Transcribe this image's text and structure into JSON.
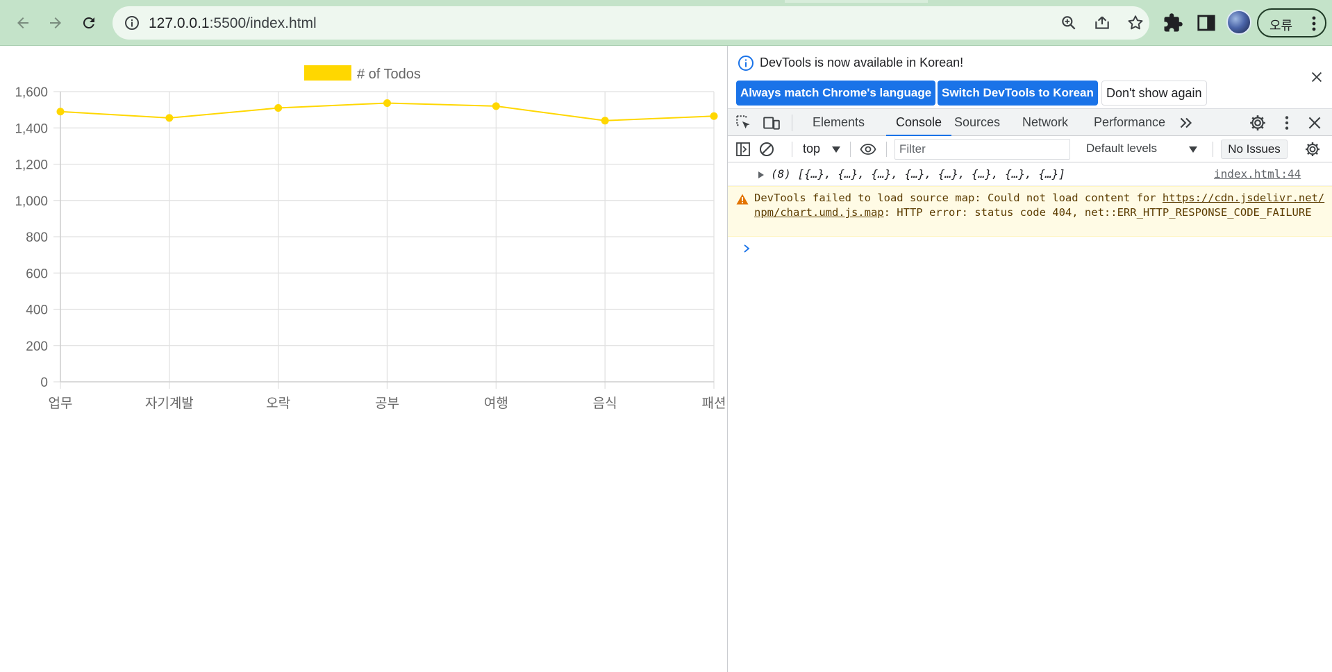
{
  "browser": {
    "url_host": "127.0.0.1",
    "url_path": ":5500/index.html",
    "profile_chip_label": "오류"
  },
  "chart_data": {
    "type": "line",
    "categories": [
      "업무",
      "자기계발",
      "오락",
      "공부",
      "여행",
      "음식",
      "패션"
    ],
    "series": [
      {
        "name": "# of Todos",
        "values": [
          1490,
          1455,
          1510,
          1537,
          1520,
          1440,
          1465
        ],
        "color": "#ffd700"
      }
    ],
    "y_ticks": [
      "0",
      "200",
      "400",
      "600",
      "800",
      "1,000",
      "1,200",
      "1,400",
      "1,600"
    ],
    "ylim": [
      0,
      1600
    ],
    "grid": true,
    "legend_position": "top"
  },
  "devtools": {
    "banner": {
      "message": "DevTools is now available in Korean!",
      "btn_match": "Always match Chrome's language",
      "btn_switch": "Switch DevTools to Korean",
      "btn_dismiss": "Don't show again"
    },
    "tabs": [
      "Elements",
      "Console",
      "Sources",
      "Network",
      "Performance"
    ],
    "active_tab": "Console",
    "console_bar": {
      "context": "top",
      "filter_placeholder": "Filter",
      "levels": "Default levels",
      "issues": "No Issues"
    },
    "log": {
      "object_line": "(8) [{…}, {…}, {…}, {…}, {…}, {…}, {…}, {…}]",
      "object_source": "index.html:44",
      "warning_prefix": "DevTools failed to load source map: Could not load content for ",
      "warning_link": "https://cdn.jsdelivr.net/npm/chart.umd.js.map",
      "warning_suffix": ": HTTP error: status code 404, net::ERR_HTTP_RESPONSE_CODE_FAILURE"
    }
  }
}
